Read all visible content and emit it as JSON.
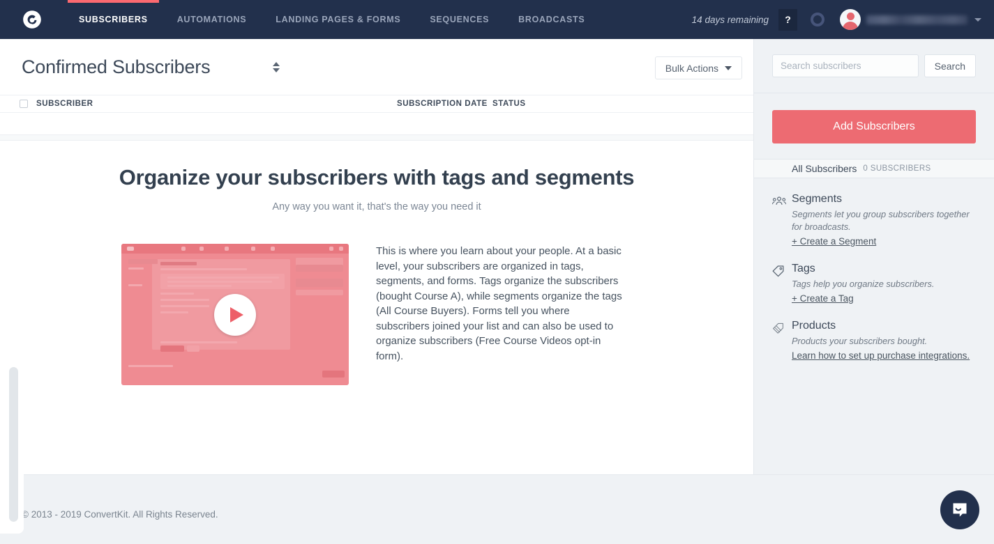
{
  "brand": {
    "logo_icon": "convertkit-logo-icon",
    "navy": "#22304c",
    "accent": "#ed6b72"
  },
  "navbar": {
    "tabs": [
      {
        "label": "SUBSCRIBERS",
        "active": true
      },
      {
        "label": "AUTOMATIONS",
        "active": false
      },
      {
        "label": "LANDING PAGES & FORMS",
        "active": false
      },
      {
        "label": "SEQUENCES",
        "active": false
      },
      {
        "label": "BROADCASTS",
        "active": false
      }
    ],
    "trial_text": "14 days remaining",
    "help_label": "?",
    "help_icon": "question-mark-icon",
    "status_icon": "progress-ring-icon",
    "avatar_icon": "user-avatar-icon",
    "account_name": "",
    "caret_icon": "chevron-down-icon"
  },
  "page": {
    "title": "Confirmed Subscribers",
    "sort_icon": "sort-up-down-icon",
    "bulk_actions_label": "Bulk Actions"
  },
  "table": {
    "columns": [
      "SUBSCRIBER",
      "SUBSCRIPTION DATE",
      "STATUS"
    ],
    "rows": []
  },
  "empty_state": {
    "heading": "Organize your subscribers with tags and segments",
    "subheading": "Any way you want it, that's the way you need it",
    "video_play_icon": "play-button-icon",
    "paragraph": "This is where you learn about your people. At a basic level, your subscribers are organized in tags, segments, and forms. Tags organize the subscribers (bought Course A), while segments organize the tags (All Course Buyers). Forms tell you where subscribers joined your list and can also be used to organize subscribers (Free Course Videos opt-in form)."
  },
  "sidebar": {
    "search": {
      "placeholder": "Search subscribers",
      "value": "",
      "button_label": "Search"
    },
    "add_subscribers_label": "Add Subscribers",
    "all_subscribers": {
      "label": "All Subscribers",
      "count_text": "0 SUBSCRIBERS"
    },
    "sections": [
      {
        "icon": "people-group-icon",
        "title": "Segments",
        "desc": "Segments let you group subscribers together for broadcasts.",
        "link": "+ Create a Segment"
      },
      {
        "icon": "tag-icon",
        "title": "Tags",
        "desc": "Tags help you organize subscribers.",
        "link": "+ Create a Tag"
      },
      {
        "icon": "product-tag-icon",
        "title": "Products",
        "desc": "Products your subscribers bought.",
        "link": "Learn how to set up purchase integrations."
      }
    ]
  },
  "footer": {
    "copyright": "© 2013 - 2019 ConvertKit. All Rights Reserved."
  },
  "chat_widget": {
    "icon": "intercom-chat-icon"
  }
}
